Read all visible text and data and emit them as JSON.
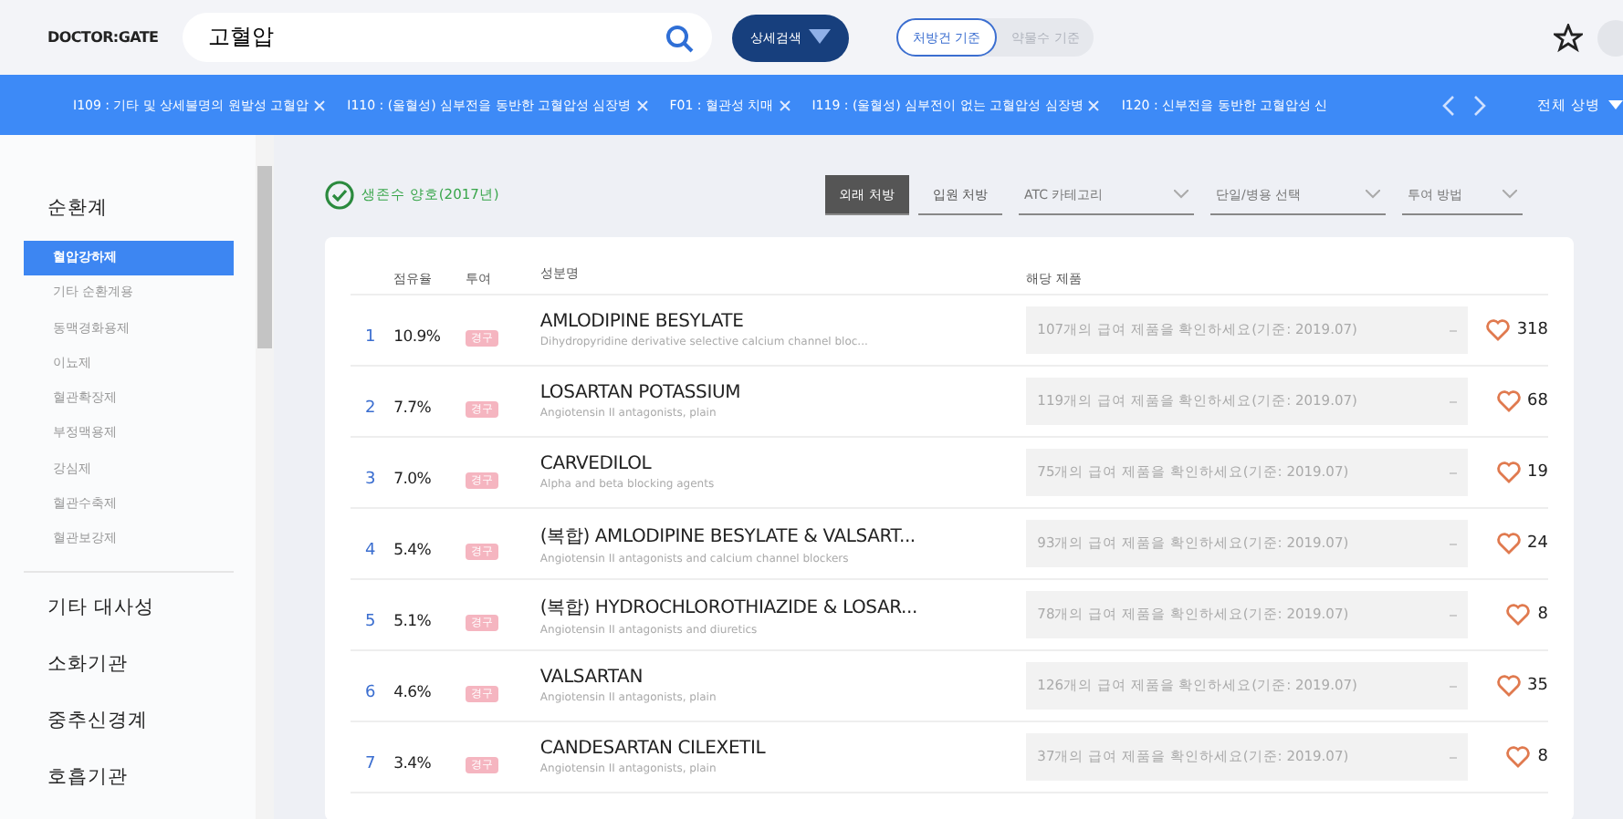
{
  "header": {
    "logo": "DOCTOR:GATE",
    "search": {
      "value": "고혈압"
    },
    "detail_button": "상세검색",
    "basis_toggle": [
      {
        "label": "처방건 기준",
        "selected": true
      },
      {
        "label": "약물수 기준",
        "selected": false
      }
    ]
  },
  "tag_bar": {
    "tags": [
      "I109 : 기타 및 상세불명의 원발성 고혈압",
      "I110 : (울혈성) 심부전을 동반한 고혈압성 심장병",
      "F01 : 혈관성 치매",
      "I119 : (울혈성) 심부전이 없는 고혈압성 심장병",
      "I120 : 신부전을 동반한 고혈압성 신"
    ],
    "all_button": "전체 상병"
  },
  "sidebar": {
    "groups": [
      {
        "label": "순환계",
        "children": [
          {
            "label": "혈압강하제",
            "selected": true
          },
          {
            "label": "기타 순환계용",
            "selected": false
          },
          {
            "label": "동맥경화용제",
            "selected": false
          },
          {
            "label": "이뇨제",
            "selected": false
          },
          {
            "label": "혈관확장제",
            "selected": false
          },
          {
            "label": "부정맥용제",
            "selected": false
          },
          {
            "label": "강심제",
            "selected": false
          },
          {
            "label": "혈관수축제",
            "selected": false
          },
          {
            "label": "혈관보강제",
            "selected": false
          }
        ]
      },
      {
        "label": "기타 대사성"
      },
      {
        "label": "소화기관"
      },
      {
        "label": "중추신경계"
      },
      {
        "label": "호흡기관"
      }
    ]
  },
  "status": "생존수 양호(2017년)",
  "filters": {
    "tabs": [
      {
        "label": "외래 처방",
        "selected": true
      },
      {
        "label": "입원 처방",
        "selected": false
      }
    ],
    "dropdowns": [
      "ATC 카테고리",
      "단일/병용 선택",
      "투여 방법"
    ]
  },
  "table": {
    "columns": [
      "점유율",
      "투여",
      "성분명",
      "해당 제품"
    ],
    "rows": [
      {
        "rank": "1",
        "share": "10.9%",
        "route": "경구",
        "name": "AMLODIPINE BESYLATE",
        "desc": "Dihydropyridine derivative selective calcium channel bloc...",
        "products": "107개의 급여 제품을 확인하세요(기준: 2019.07)",
        "likes": "318"
      },
      {
        "rank": "2",
        "share": "7.7%",
        "route": "경구",
        "name": "LOSARTAN POTASSIUM",
        "desc": "Angiotensin II antagonists, plain",
        "products": "119개의 급여 제품을 확인하세요(기준: 2019.07)",
        "likes": "68"
      },
      {
        "rank": "3",
        "share": "7.0%",
        "route": "경구",
        "name": "CARVEDILOL",
        "desc": "Alpha and beta blocking agents",
        "products": "75개의 급여 제품을 확인하세요(기준: 2019.07)",
        "likes": "19"
      },
      {
        "rank": "4",
        "share": "5.4%",
        "route": "경구",
        "name": "(복합) AMLODIPINE BESYLATE & VALSART...",
        "desc": "Angiotensin II antagonists and calcium channel blockers",
        "products": "93개의 급여 제품을 확인하세요(기준: 2019.07)",
        "likes": "24"
      },
      {
        "rank": "5",
        "share": "5.1%",
        "route": "경구",
        "name": "(복합) HYDROCHLOROTHIAZIDE & LOSAR...",
        "desc": "Angiotensin II antagonists and diuretics",
        "products": "78개의 급여 제품을 확인하세요(기준: 2019.07)",
        "likes": "8"
      },
      {
        "rank": "6",
        "share": "4.6%",
        "route": "경구",
        "name": "VALSARTAN",
        "desc": "Angiotensin II antagonists, plain",
        "products": "126개의 급여 제품을 확인하세요(기준: 2019.07)",
        "likes": "35"
      },
      {
        "rank": "7",
        "share": "3.4%",
        "route": "경구",
        "name": "CANDESARTAN CILEXETIL",
        "desc": "Angiotensin II antagonists, plain",
        "products": "37개의 급여 제품을 확인하세요(기준: 2019.07)",
        "likes": "8"
      }
    ]
  }
}
